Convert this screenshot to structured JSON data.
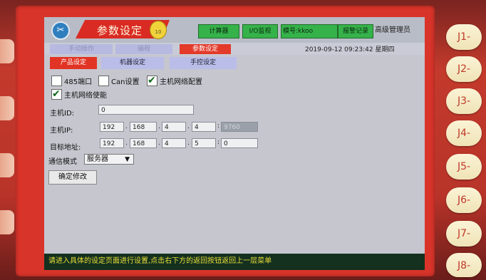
{
  "header": {
    "title": "参数设定",
    "hand_badge": "10",
    "buttons": [
      "计算器",
      "I/O监视",
      "模号:kkoo",
      "报警记录"
    ],
    "admin": "高级管理员"
  },
  "nav": {
    "items": [
      "手动操作",
      "编程",
      "参数设定"
    ],
    "active_index": 2,
    "datetime": "2019-09-12  09:23:42  星期四"
  },
  "tabs": {
    "items": [
      "产品设定",
      "机器设定",
      "手控设定"
    ],
    "active_index": 0
  },
  "form": {
    "port485": {
      "label": "485端口",
      "checked": false
    },
    "can": {
      "label": "Can设置",
      "checked": false
    },
    "host_net_cfg": {
      "label": "主机网络配置",
      "checked": true
    },
    "host_net_enable": {
      "label": "主机网络使能",
      "checked": true
    },
    "host_id_label": "主机ID:",
    "host_id_value": "0",
    "host_ip_label": "主机IP:",
    "host_ip": [
      "192",
      "168",
      "4",
      "4"
    ],
    "host_port": "9760",
    "target_label": "目标地址:",
    "target_ip": [
      "192",
      "168",
      "4",
      "5"
    ],
    "target_port": "0",
    "comm_mode_label": "通信模式",
    "comm_mode_value": "服务器",
    "confirm_label": "确定修改"
  },
  "status_text": "请进入具体的设定页面进行设置,点击右下方的返回按钮返回上一层菜单",
  "side_keys": [
    "J1-",
    "J2-",
    "J3-",
    "J4-",
    "J5-",
    "J6-",
    "J7-",
    "J8-"
  ],
  "colors": {
    "accent_red": "#e23424",
    "status_bg": "#14301f",
    "status_text": "#e9df39",
    "green_button": "#36b24a"
  }
}
